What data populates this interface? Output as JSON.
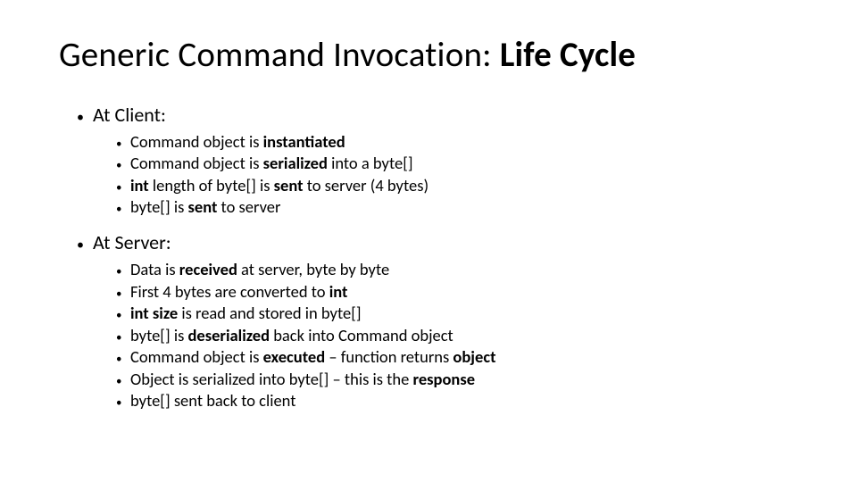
{
  "title": {
    "plain": "Generic Command Invocation: ",
    "emph": "Life Cycle"
  },
  "sections": [
    {
      "heading": "At Client:",
      "items": [
        [
          {
            "t": "Command object is ",
            "b": false
          },
          {
            "t": "instantiated",
            "b": true
          }
        ],
        [
          {
            "t": "Command object is ",
            "b": false
          },
          {
            "t": "serialized",
            "b": true
          },
          {
            "t": " into a byte[]",
            "b": false
          }
        ],
        [
          {
            "t": "int",
            "b": true
          },
          {
            "t": " length of byte[] is ",
            "b": false
          },
          {
            "t": "sent",
            "b": true
          },
          {
            "t": " to server (4 bytes)",
            "b": false
          }
        ],
        [
          {
            "t": "byte[] is ",
            "b": false
          },
          {
            "t": "sent",
            "b": true
          },
          {
            "t": " to server",
            "b": false
          }
        ]
      ]
    },
    {
      "heading": "At Server:",
      "items": [
        [
          {
            "t": "Data is ",
            "b": false
          },
          {
            "t": "received",
            "b": true
          },
          {
            "t": " at server, byte by byte",
            "b": false
          }
        ],
        [
          {
            "t": "First 4 bytes are converted to ",
            "b": false
          },
          {
            "t": "int",
            "b": true
          }
        ],
        [
          {
            "t": "int size",
            "b": true
          },
          {
            "t": " is read and stored in byte[]",
            "b": false
          }
        ],
        [
          {
            "t": "byte[] is ",
            "b": false
          },
          {
            "t": "deserialized",
            "b": true
          },
          {
            "t": " back into Command object",
            "b": false
          }
        ],
        [
          {
            "t": "Command object is ",
            "b": false
          },
          {
            "t": "executed",
            "b": true
          },
          {
            "t": " – function returns ",
            "b": false
          },
          {
            "t": "object",
            "b": true
          }
        ],
        [
          {
            "t": "Object is serialized into byte[] – this is the ",
            "b": false
          },
          {
            "t": "response",
            "b": true
          }
        ],
        [
          {
            "t": "byte[] sent back to client",
            "b": false
          }
        ]
      ]
    }
  ]
}
